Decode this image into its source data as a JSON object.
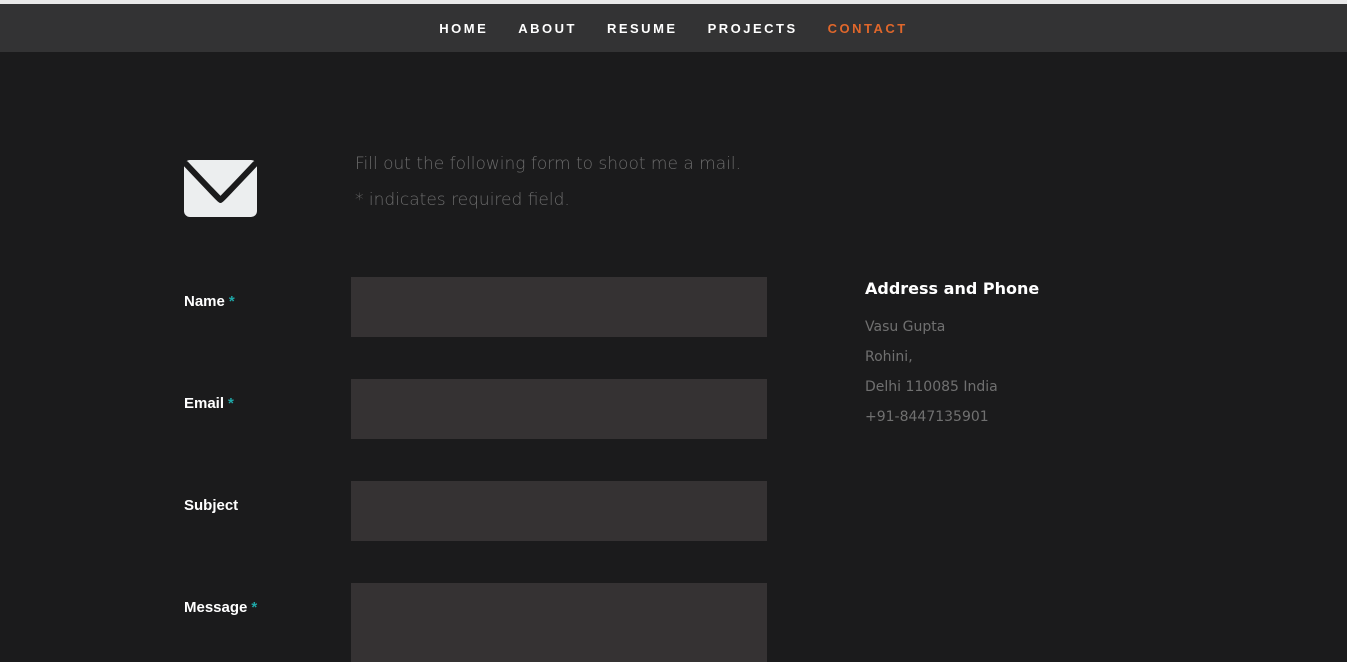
{
  "nav": {
    "items": [
      {
        "label": "HOME"
      },
      {
        "label": "ABOUT"
      },
      {
        "label": "RESUME"
      },
      {
        "label": "PROJECTS"
      },
      {
        "label": "CONTACT",
        "active": true
      }
    ],
    "active_color": "#e0672b"
  },
  "intro": {
    "line1": "Fill out the following form to shoot me a mail.",
    "line2": "* indicates required field."
  },
  "icons": {
    "mail": "envelope-icon"
  },
  "form": {
    "required_marker": "*",
    "required_color": "#1fa7a7",
    "fields": {
      "name": {
        "label": "Name",
        "value": "",
        "required": true
      },
      "email": {
        "label": "Email",
        "value": "",
        "required": true
      },
      "subject": {
        "label": "Subject",
        "value": "",
        "required": false
      },
      "message": {
        "label": "Message",
        "value": "",
        "required": true
      }
    }
  },
  "address": {
    "title": "Address and Phone",
    "lines": [
      "Vasu Gupta",
      "Rohini,",
      "Delhi 110085 India",
      "+91-8447135901"
    ]
  }
}
